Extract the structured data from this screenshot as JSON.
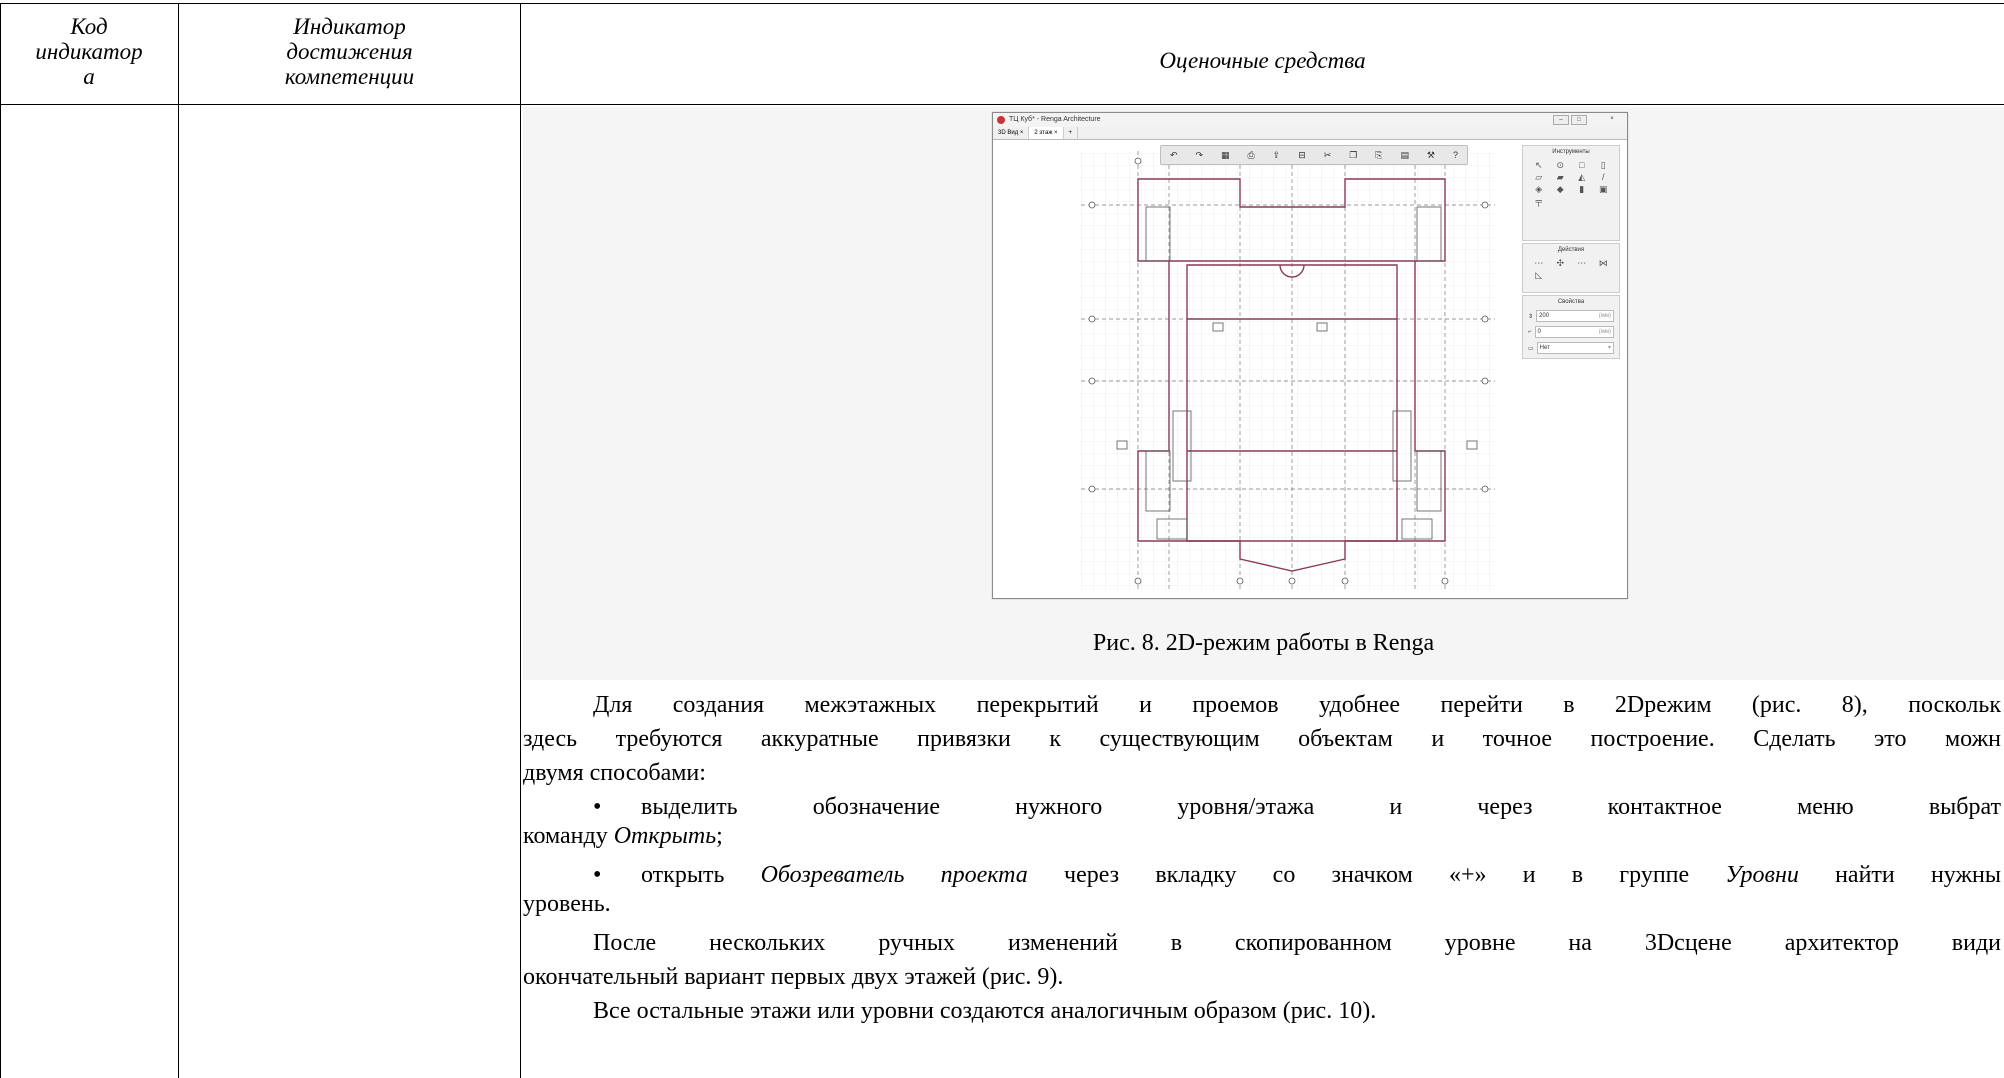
{
  "table": {
    "headers": {
      "code": [
        "Код",
        "индикатор",
        "а"
      ],
      "indicator": [
        "Индикатор",
        "достижения",
        "компетенции"
      ],
      "assessment": "Оценочные средства"
    }
  },
  "figure": {
    "window_title": "ТЦ Куб* - Renga Architecture",
    "tabs": [
      "3D Вид ×",
      "2 этаж ×",
      "+"
    ],
    "toolbar_icons": [
      "undo-icon",
      "redo-icon",
      "grid-icon",
      "print-icon",
      "export-icon",
      "printer-icon",
      "cut-icon",
      "copy-icon",
      "paste-icon",
      "view-icon",
      "wrench-icon",
      "help-icon"
    ],
    "panel_tools": {
      "title": "Инструменты"
    },
    "panel_actions": {
      "title": "Действия"
    },
    "panel_props": {
      "title": "Свойства",
      "field1_value": "200",
      "field1_unit": "(мм)",
      "field2_value": "0",
      "field2_unit": "(мм)",
      "field3_value": "Нет"
    },
    "caption": "Рис. 8. 2D-режим работы в Renga"
  },
  "body": {
    "p1_line1": "Для создания межэтажных перекрытий и проемов удобнее перейти в 2Dрежим (рис. 8), поскольк",
    "p1_line2": "здесь требуются аккуратные привязки к существующим объектам и точное построение. Сделать это можн",
    "p1_line3": "двумя способами:",
    "b1_line1": "выделить обозначение нужного уровня/этажа и через контактное меню выбрат",
    "b1_line2_pre": "команду ",
    "b1_line2_em": "Открыть",
    "b1_line2_post": ";",
    "b2_pre": "открыть ",
    "b2_em1": "Обозреватель проекта",
    "b2_mid": " через вкладку со значком «+» и в группе ",
    "b2_em2": "Уровни",
    "b2_post": " найти нужны",
    "b2_line2": "уровень.",
    "p2_line1": "После нескольких ручных изменений в скопированном уровне на 3Dсцене архитектор види",
    "p2_line2": "окончательный вариант первых двух этажей (рис. 9).",
    "p3_line1": "Все остальные этажи или уровни создаются аналогичным образом (рис. 10)."
  }
}
